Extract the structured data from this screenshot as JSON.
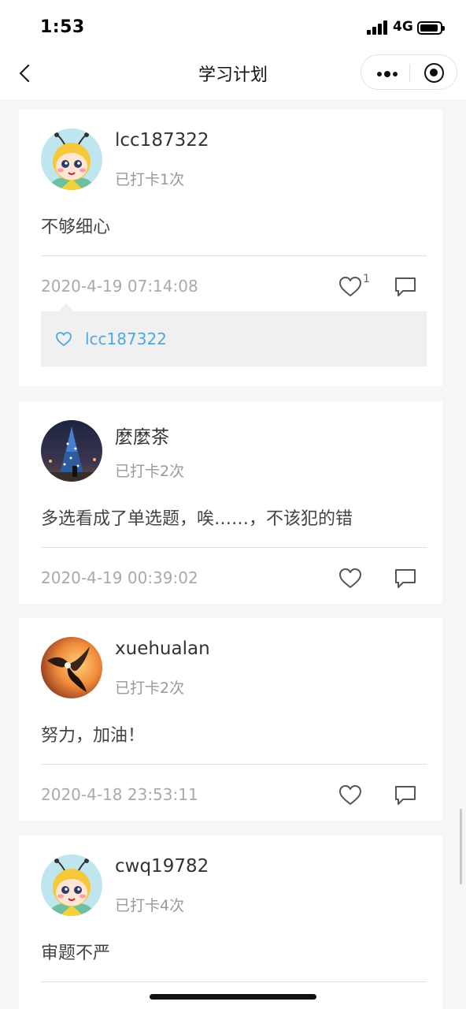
{
  "status_bar": {
    "time": "1:53",
    "network": "4G"
  },
  "nav": {
    "title": "学习计划"
  },
  "posts": [
    {
      "username": "lcc187322",
      "checkin": "已打卡1次",
      "content": "不够细心",
      "date": "2020-4-19 07:14:08",
      "like_count": "1",
      "likers": [
        "lcc187322"
      ]
    },
    {
      "username": "麼麼茶",
      "checkin": "已打卡2次",
      "content": "多选看成了单选题，唉……，不该犯的错",
      "date": "2020-4-19 00:39:02",
      "like_count": "",
      "likers": []
    },
    {
      "username": "xuehualan",
      "checkin": "已打卡2次",
      "content": "努力，加油！",
      "date": "2020-4-18 23:53:11",
      "like_count": "",
      "likers": []
    },
    {
      "username": "cwq19782",
      "checkin": "已打卡4次",
      "content": "审题不严",
      "date": "",
      "like_count": "",
      "likers": []
    }
  ],
  "colors": {
    "accent": "#4da9dd",
    "background": "#f6f6f6",
    "muted": "#999999"
  }
}
